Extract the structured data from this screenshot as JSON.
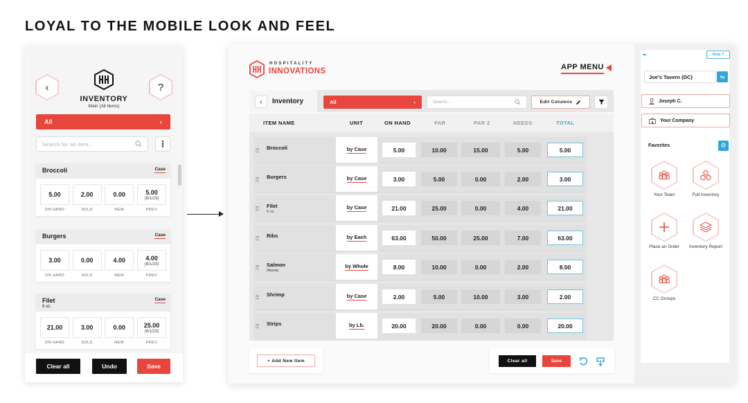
{
  "headline": "LOYAL TO THE MOBILE LOOK AND FEEL",
  "colors": {
    "accent": "#e8453c",
    "blue": "#31a6d7",
    "dark": "#111111"
  },
  "mobile": {
    "title": "INVENTORY",
    "subtitle": "Main (All Items)",
    "filter_label": "All",
    "search_placeholder": "Search for an item...",
    "back_icon": "chevron-left-icon",
    "help_label": "?",
    "cards": [
      {
        "name": "Broccoli",
        "note": "",
        "unit": "Case",
        "values": [
          "5.00",
          "2.00",
          "0.00",
          "5.00"
        ],
        "prev_date": ""
      },
      {
        "name": "Burgers",
        "note": "",
        "unit": "Case",
        "values": [
          "3.00",
          "0.00",
          "4.00",
          "4.00"
        ],
        "prev_date": "(8/1/23)"
      },
      {
        "name": "Filet",
        "note": "6 oz.",
        "unit": "Case",
        "values": [
          "21.00",
          "3.00",
          "0.00",
          "25.00"
        ],
        "prev_date": "(8/1/23)"
      }
    ],
    "first_prev_date": "(8/1/23)",
    "labels": [
      "ON HAND",
      "SOLD",
      "NEW",
      "PREV"
    ],
    "buttons": {
      "clear": "Clear all",
      "undo": "Undo",
      "save": "Save"
    }
  },
  "tablet": {
    "brand_top": "HOSPITALITY",
    "brand_bottom": "INNOVATIONS",
    "app_menu": "APP MENU",
    "inventory_label": "Inventory",
    "filter_label": "All",
    "search_placeholder": "Search...",
    "edit_columns": "Edit Columns",
    "columns": [
      "ITEM NAME",
      "UNIT",
      "ON HAND",
      "PAR",
      "PAR 2",
      "NEEDS",
      "TOTAL"
    ],
    "rows": [
      {
        "name": "Broccoli",
        "note": "",
        "unit": "by Case",
        "on_hand": "5.00",
        "par": "10.00",
        "par2": "15.00",
        "needs": "5.00",
        "total": "5.00"
      },
      {
        "name": "Burgers",
        "note": "",
        "unit": "by Case",
        "on_hand": "3.00",
        "par": "5.00",
        "par2": "0.00",
        "needs": "2.00",
        "total": "3.00"
      },
      {
        "name": "Filet",
        "note": "6 oz.",
        "unit": "by Case",
        "on_hand": "21.00",
        "par": "25.00",
        "par2": "0.00",
        "needs": "4.00",
        "total": "21.00"
      },
      {
        "name": "Ribs",
        "note": "",
        "unit": "by Each",
        "on_hand": "63.00",
        "par": "50.00",
        "par2": "25.00",
        "needs": "7.00",
        "total": "63.00"
      },
      {
        "name": "Salmon",
        "note": "Atlantic",
        "unit": "by Whole",
        "on_hand": "8.00",
        "par": "10.00",
        "par2": "0.00",
        "needs": "2.00",
        "total": "8.00"
      },
      {
        "name": "Shrimp",
        "note": "",
        "unit": "by Case",
        "on_hand": "2.00",
        "par": "5.00",
        "par2": "10.00",
        "needs": "3.00",
        "total": "2.00"
      },
      {
        "name": "Strips",
        "note": "",
        "unit": "by Lb.",
        "on_hand": "20.00",
        "par": "20.00",
        "par2": "0.00",
        "needs": "0.00",
        "total": "20.00"
      }
    ],
    "add_item": "+ Add New Item",
    "clear_all": "Clear all",
    "save": "Save",
    "sidebar": {
      "help": "Help ?",
      "venue": "Joe's Tavern (DC)",
      "user": "Joseph C.",
      "company": "Your Company",
      "favorites_title": "Favorites",
      "favorites": [
        "Your Team",
        "Full Inventory",
        "Place an Order",
        "Inventory Report",
        "CC Groups"
      ]
    }
  }
}
